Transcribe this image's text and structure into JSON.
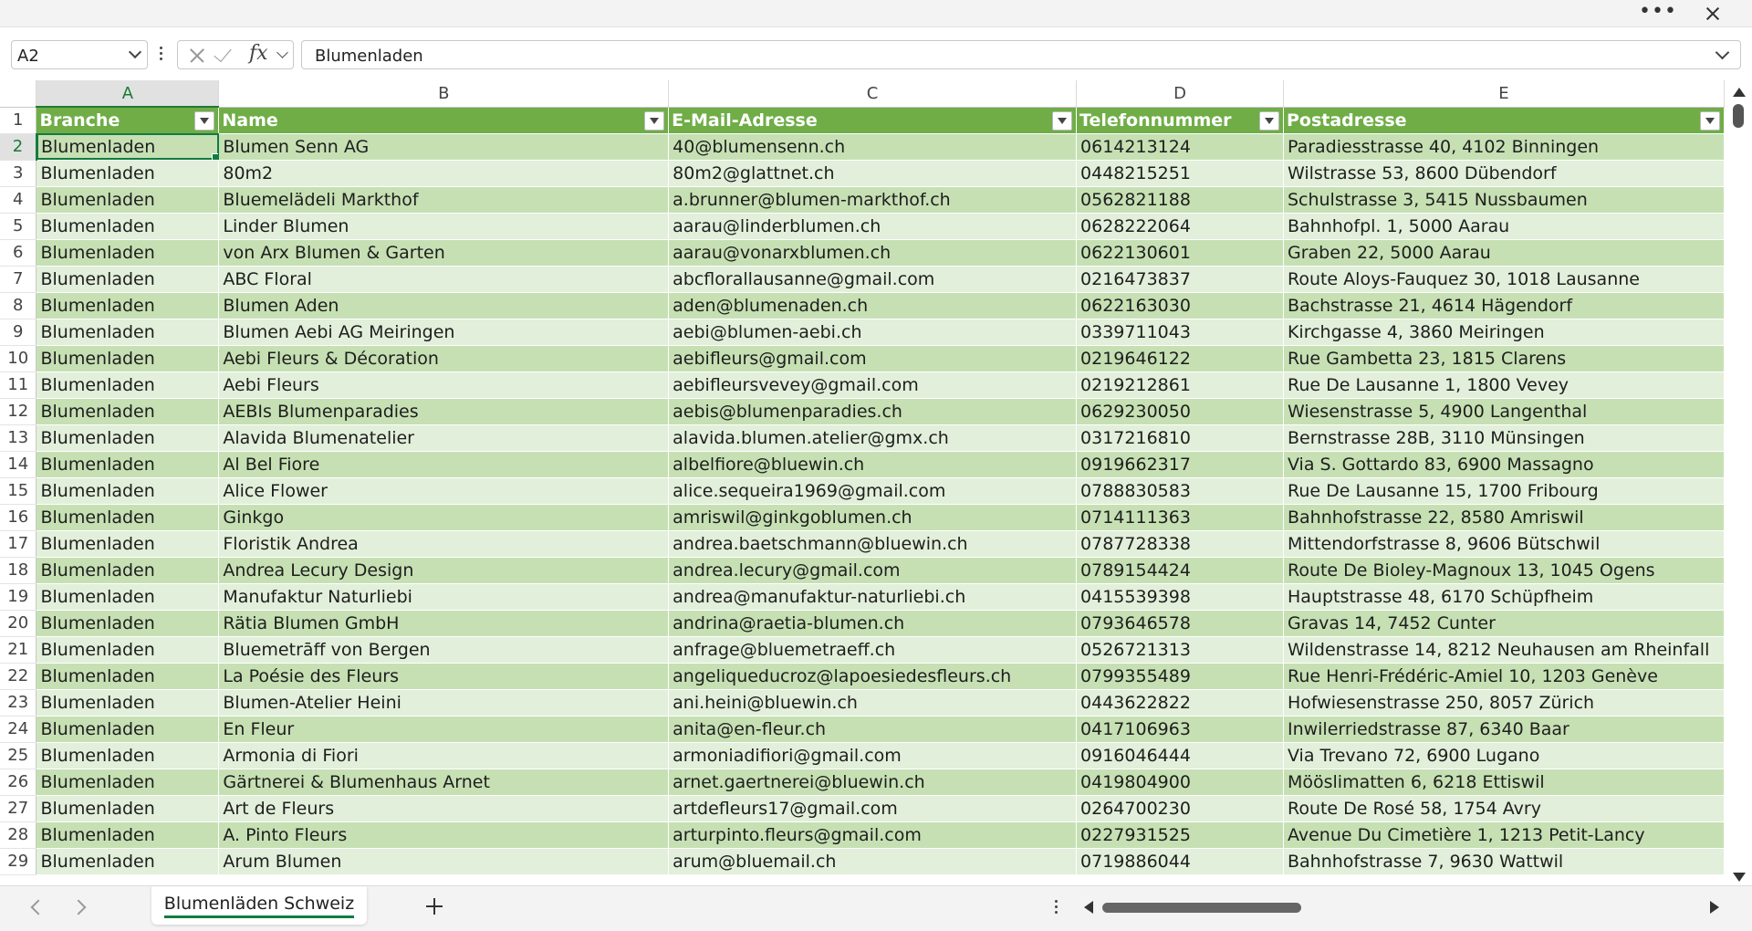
{
  "title_bar": {
    "more_label": "•••"
  },
  "formula_bar": {
    "name_box": "A2",
    "fx_label": "fx",
    "formula_value": "Blumenladen"
  },
  "columns": [
    "A",
    "B",
    "C",
    "D",
    "E"
  ],
  "headers": [
    "Branche",
    "Name",
    "E-Mail-Adresse",
    "Telefonnummer",
    "Postadresse"
  ],
  "rows": [
    {
      "n": "2",
      "cells": [
        "Blumenladen",
        "Blumen Senn AG",
        "40@blumensenn.ch",
        "0614213124",
        "Paradiesstrasse 40, 4102 Binningen"
      ]
    },
    {
      "n": "3",
      "cells": [
        "Blumenladen",
        "80m2",
        "80m2@glattnet.ch",
        "0448215251",
        "Wilstrasse 53, 8600 Dübendorf"
      ]
    },
    {
      "n": "4",
      "cells": [
        "Blumenladen",
        "Bluemelädeli Markthof",
        "a.brunner@blumen-markthof.ch",
        "0562821188",
        "Schulstrasse 3, 5415 Nussbaumen"
      ]
    },
    {
      "n": "5",
      "cells": [
        "Blumenladen",
        "Linder Blumen",
        "aarau@linderblumen.ch",
        "0628222064",
        "Bahnhofpl. 1, 5000 Aarau"
      ]
    },
    {
      "n": "6",
      "cells": [
        "Blumenladen",
        "von Arx Blumen & Garten",
        "aarau@vonarxblumen.ch",
        "0622130601",
        "Graben 22, 5000 Aarau"
      ]
    },
    {
      "n": "7",
      "cells": [
        "Blumenladen",
        "ABC Floral",
        "abcflorallausanne@gmail.com",
        "0216473837",
        "Route Aloys-Fauquez 30, 1018 Lausanne"
      ]
    },
    {
      "n": "8",
      "cells": [
        "Blumenladen",
        "Blumen Aden",
        "aden@blumenaden.ch",
        "0622163030",
        "Bachstrasse 21, 4614 Hägendorf"
      ]
    },
    {
      "n": "9",
      "cells": [
        "Blumenladen",
        "Blumen Aebi AG Meiringen",
        "aebi@blumen-aebi.ch",
        "0339711043",
        "Kirchgasse 4, 3860 Meiringen"
      ]
    },
    {
      "n": "10",
      "cells": [
        "Blumenladen",
        "Aebi Fleurs & Décoration",
        "aebifleurs@gmail.com",
        "0219646122",
        "Rue Gambetta 23, 1815 Clarens"
      ]
    },
    {
      "n": "11",
      "cells": [
        "Blumenladen",
        "Aebi Fleurs",
        "aebifleursvevey@gmail.com",
        "0219212861",
        "Rue De Lausanne 1, 1800 Vevey"
      ]
    },
    {
      "n": "12",
      "cells": [
        "Blumenladen",
        "AEBIs Blumenparadies",
        "aebis@blumenparadies.ch",
        "0629230050",
        "Wiesenstrasse 5, 4900 Langenthal"
      ]
    },
    {
      "n": "13",
      "cells": [
        "Blumenladen",
        "Alavida Blumenatelier",
        "alavida.blumen.atelier@gmx.ch",
        "0317216810",
        "Bernstrasse 28B, 3110 Münsingen"
      ]
    },
    {
      "n": "14",
      "cells": [
        "Blumenladen",
        "Al Bel Fiore",
        "albelfiore@bluewin.ch",
        "0919662317",
        "Via S. Gottardo 83, 6900 Massagno"
      ]
    },
    {
      "n": "15",
      "cells": [
        "Blumenladen",
        "Alice Flower",
        "alice.sequeira1969@gmail.com",
        "0788830583",
        "Rue De Lausanne 15, 1700 Fribourg"
      ]
    },
    {
      "n": "16",
      "cells": [
        "Blumenladen",
        "Ginkgo",
        "amriswil@ginkgoblumen.ch",
        "0714111363",
        "Bahnhofstrasse 22, 8580 Amriswil"
      ]
    },
    {
      "n": "17",
      "cells": [
        "Blumenladen",
        "Floristik Andrea",
        "andrea.baetschmann@bluewin.ch",
        "0787728338",
        "Mittendorfstrasse 8, 9606 Bütschwil"
      ]
    },
    {
      "n": "18",
      "cells": [
        "Blumenladen",
        "Andrea Lecury Design",
        "andrea.lecury@gmail.com",
        "0789154424",
        "Route De Bioley-Magnoux 13, 1045 Ogens"
      ]
    },
    {
      "n": "19",
      "cells": [
        "Blumenladen",
        "Manufaktur Naturliebi",
        "andrea@manufaktur-naturliebi.ch",
        "0415539398",
        "Hauptstrasse 48, 6170 Schüpfheim"
      ]
    },
    {
      "n": "20",
      "cells": [
        "Blumenladen",
        "Rätia Blumen GmbH",
        "andrina@raetia-blumen.ch",
        "0793646578",
        "Gravas 14, 7452 Cunter"
      ]
    },
    {
      "n": "21",
      "cells": [
        "Blumenladen",
        "Bluemetrāff von Bergen",
        "anfrage@bluemetraeff.ch",
        "0526721313",
        "Wildenstrasse 14, 8212 Neuhausen am Rheinfall"
      ]
    },
    {
      "n": "22",
      "cells": [
        "Blumenladen",
        "La Poésie des Fleurs",
        "angeliqueducroz@lapoesiedesfleurs.ch",
        "0799355489",
        "Rue Henri-Frédéric-Amiel 10, 1203 Genève"
      ]
    },
    {
      "n": "23",
      "cells": [
        "Blumenladen",
        "Blumen-Atelier Heini",
        "ani.heini@bluewin.ch",
        "0443622822",
        "Hofwiesenstrasse 250, 8057 Zürich"
      ]
    },
    {
      "n": "24",
      "cells": [
        "Blumenladen",
        "En Fleur",
        "anita@en-fleur.ch",
        "0417106963",
        "Inwilerriedstrasse 87, 6340 Baar"
      ]
    },
    {
      "n": "25",
      "cells": [
        "Blumenladen",
        "Armonia di Fiori",
        "armoniadifiori@gmail.com",
        "0916046444",
        "Via Trevano 72, 6900 Lugano"
      ]
    },
    {
      "n": "26",
      "cells": [
        "Blumenladen",
        "Gärtnerei & Blumenhaus Arnet",
        "arnet.gaertnerei@bluewin.ch",
        "0419804900",
        "Mööslimatten 6, 6218 Ettiswil"
      ]
    },
    {
      "n": "27",
      "cells": [
        "Blumenladen",
        "Art de Fleurs",
        "artdefleurs17@gmail.com",
        "0264700230",
        "Route De Rosé 58, 1754 Avry"
      ]
    },
    {
      "n": "28",
      "cells": [
        "Blumenladen",
        "A. Pinto Fleurs",
        "arturpinto.fleurs@gmail.com",
        "0227931525",
        "Avenue Du Cimetière 1, 1213 Petit-Lancy"
      ]
    },
    {
      "n": "29",
      "cells": [
        "Blumenladen",
        "Arum Blumen",
        "arum@bluemail.ch",
        "0719886044",
        "Bahnhofstrasse 7, 9630 Wattwil"
      ]
    }
  ],
  "sheet_tab": "Blumenläden Schweiz",
  "colors": {
    "header_green": "#70ad47",
    "band_dark": "#c6e0b4",
    "band_light": "#e2efda",
    "accent": "#107c41"
  }
}
